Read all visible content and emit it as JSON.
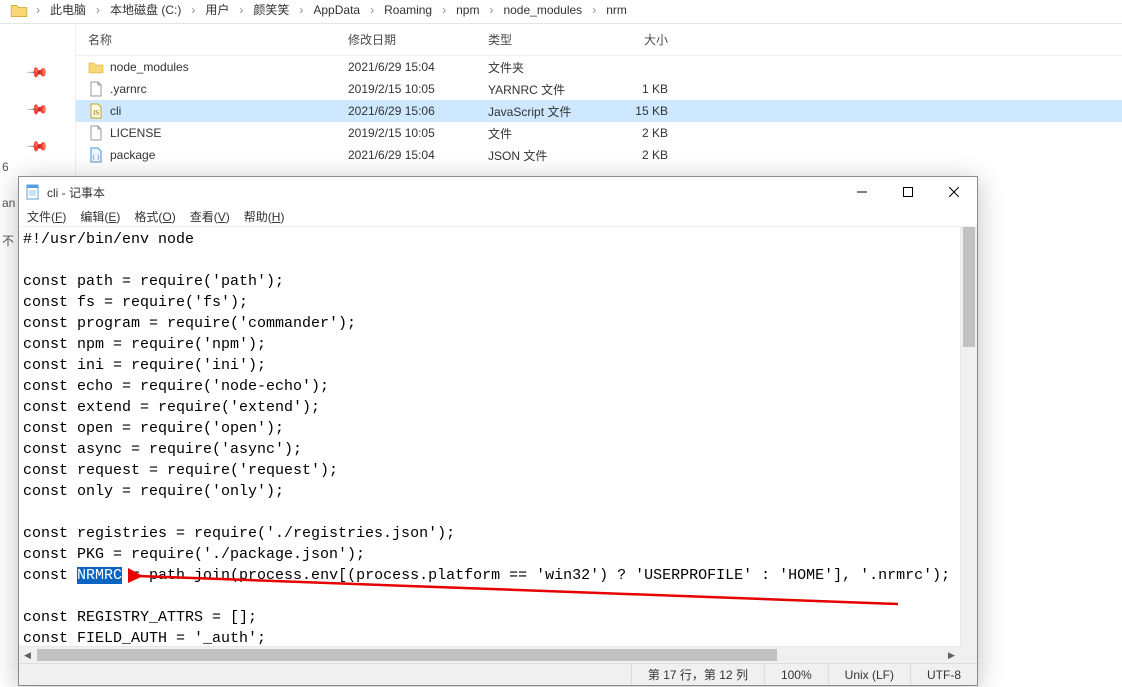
{
  "breadcrumb": [
    "此电脑",
    "本地磁盘 (C:)",
    "用户",
    "颜笑笑",
    "AppData",
    "Roaming",
    "npm",
    "node_modules",
    "nrm"
  ],
  "columns": {
    "name": "名称",
    "date": "修改日期",
    "type": "类型",
    "size": "大小"
  },
  "files": [
    {
      "icon": "folder",
      "name": "node_modules",
      "date": "2021/6/29 15:04",
      "type": "文件夹",
      "size": "",
      "selected": false
    },
    {
      "icon": "file",
      "name": ".yarnrc",
      "date": "2019/2/15 10:05",
      "type": "YARNRC 文件",
      "size": "1 KB",
      "selected": false
    },
    {
      "icon": "js",
      "name": "cli",
      "date": "2021/6/29 15:06",
      "type": "JavaScript 文件",
      "size": "15 KB",
      "selected": true
    },
    {
      "icon": "file",
      "name": "LICENSE",
      "date": "2019/2/15 10:05",
      "type": "文件",
      "size": "2 KB",
      "selected": false
    },
    {
      "icon": "json",
      "name": "package",
      "date": "2021/6/29 15:04",
      "type": "JSON 文件",
      "size": "2 KB",
      "selected": false
    }
  ],
  "left_cutoff": [
    "6",
    "an",
    "不"
  ],
  "notepad": {
    "title": "cli - 记事本",
    "menus": {
      "file": {
        "label": "文件",
        "ul": "F"
      },
      "edit": {
        "label": "编辑",
        "ul": "E"
      },
      "format": {
        "label": "格式",
        "ul": "O"
      },
      "view": {
        "label": "查看",
        "ul": "V"
      },
      "help": {
        "label": "帮助",
        "ul": "H"
      }
    },
    "code": {
      "l01": "#!/usr/bin/env node",
      "l02": "",
      "l03": "const path = require('path');",
      "l04": "const fs = require('fs');",
      "l05": "const program = require('commander');",
      "l06": "const npm = require('npm');",
      "l07": "const ini = require('ini');",
      "l08": "const echo = require('node-echo');",
      "l09": "const extend = require('extend');",
      "l10": "const open = require('open');",
      "l11": "const async = require('async');",
      "l12": "const request = require('request');",
      "l13": "const only = require('only');",
      "l14": "",
      "l15": "const registries = require('./registries.json');",
      "l16": "const PKG = require('./package.json');",
      "l17_pre": "const ",
      "l17_hl": "NRMRC",
      "l17_post": " = path.join(process.env[(process.platform == 'win32') ? 'USERPROFILE' : 'HOME'], '.nrmrc');",
      "l18": "",
      "l19": "const REGISTRY_ATTRS = [];",
      "l20": "const FIELD_AUTH = '_auth';"
    },
    "status": {
      "pos": "第 17 行，第 12 列",
      "zoom": "100%",
      "eol": "Unix (LF)",
      "enc": "UTF-8"
    }
  }
}
